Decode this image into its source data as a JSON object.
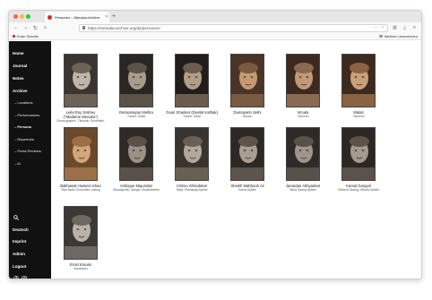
{
  "browser": {
    "tab_title": "Personen – Menaka-Archive",
    "tab_close": "×",
    "new_tab": "+",
    "url": "https://menaka-archive.org/de/personen/",
    "nav": {
      "back": "←",
      "forward": "→",
      "reload": "↻",
      "home": "⌂"
    },
    "bookmarks": {
      "left": "Erste Schritte",
      "right": "Weitere Lesezeichen"
    },
    "toolbar_icons": [
      "···",
      "☆",
      "⤓",
      "≡"
    ]
  },
  "sidebar": {
    "main": [
      "Home",
      "Journal",
      "Notes",
      "Archive"
    ],
    "archive_sub": [
      "Locations",
      "Performances",
      "Persons",
      "Repertoire",
      "Press Reviews",
      "AI"
    ],
    "active_sub": "Persons",
    "bottom": [
      "Deutsch",
      "Imprint",
      "Admin",
      "Logout"
    ]
  },
  "persons": [
    {
      "name": "Leila Roy Sokhey",
      "name2": "(\"Madame Menaka\")",
      "role": "Choreographin, Tänzerin, Ensemble-"
    },
    {
      "name": "Ramnarayan Mishra",
      "role": "Tänzer, Solist"
    },
    {
      "name": "Gauri Shankar (Devilal Kathak)",
      "role": "Tänzer, Solist"
    },
    {
      "name": "Damayanti Joshi",
      "role": "Dancer"
    },
    {
      "name": "Vimala",
      "role": "Tänzerin"
    },
    {
      "name": "Malati",
      "role": "Tänzerin"
    },
    {
      "name": "Bakhawat Hussein Khan",
      "role": "Sitar Band, Ensemble-Leitung"
    },
    {
      "name": "Ambique Majumdar",
      "role": "Sarodspieler, Sänger, Musikdirektor"
    },
    {
      "name": "Vishnu Shirodekar",
      "role": "Tabla, Pakhawaj-Spieler"
    },
    {
      "name": "Sheikh Mahboob Ali",
      "role": "Sarod-Spieler"
    },
    {
      "name": "Janardan Abhyankar",
      "role": "Tabla Tarang-Spieler"
    },
    {
      "name": "Kamal Ganguli",
      "role": "Shehnai Tarang, Dilruba-Spieler"
    },
    {
      "name": "Ernst Krauss",
      "role": "Impresario"
    }
  ]
}
